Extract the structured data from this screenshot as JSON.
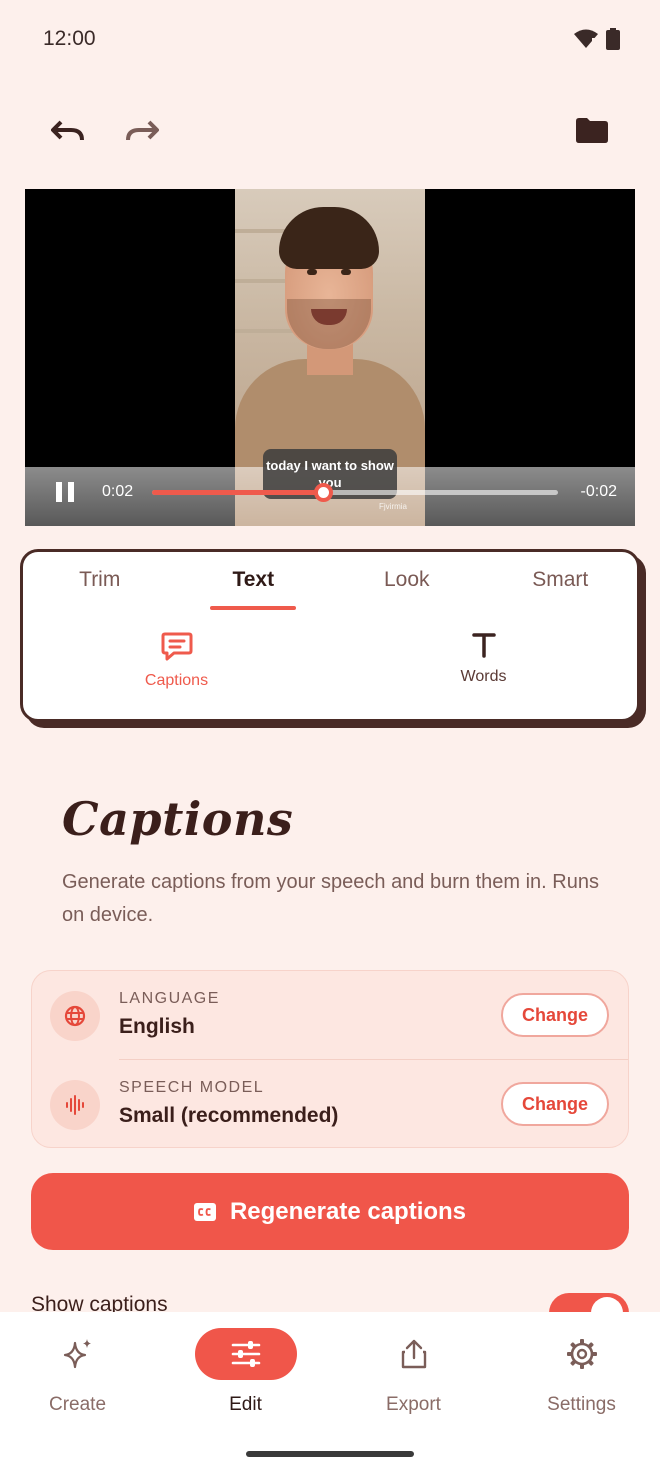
{
  "status_bar": {
    "time": "12:00"
  },
  "video": {
    "caption_overlay": "today I want to show you",
    "elapsed": "0:02",
    "remaining": "-0:02",
    "progress_fraction": 0.42,
    "watermark": "Fjvirmia"
  },
  "tool_tabs": [
    "Trim",
    "Text",
    "Look",
    "Smart"
  ],
  "active_tab": "Text",
  "sub_tools": [
    {
      "label": "Captions",
      "icon": "captions-bubble-icon",
      "active": true
    },
    {
      "label": "Words",
      "icon": "text-t-icon",
      "active": false
    }
  ],
  "section": {
    "title": "Captions",
    "description": "Generate captions from your speech and burn them in. Runs on device."
  },
  "settings": {
    "language": {
      "label": "LANGUAGE",
      "value": "English",
      "button": "Change",
      "icon": "globe-icon"
    },
    "speech_model": {
      "label": "SPEECH MODEL",
      "value": "Small (recommended)",
      "button": "Change",
      "icon": "waveform-icon"
    }
  },
  "regenerate_button": "Regenerate captions",
  "show_captions": {
    "label": "Show captions",
    "enabled": true
  },
  "bottom_nav": [
    {
      "label": "Create",
      "icon": "sparkle-icon",
      "active": false
    },
    {
      "label": "Edit",
      "icon": "sliders-icon",
      "active": true
    },
    {
      "label": "Export",
      "icon": "share-icon",
      "active": false
    },
    {
      "label": "Settings",
      "icon": "gear-icon",
      "active": false
    }
  ],
  "colors": {
    "accent": "#f0564a",
    "background": "#fdf0ec",
    "ink": "#3b1f1b"
  }
}
